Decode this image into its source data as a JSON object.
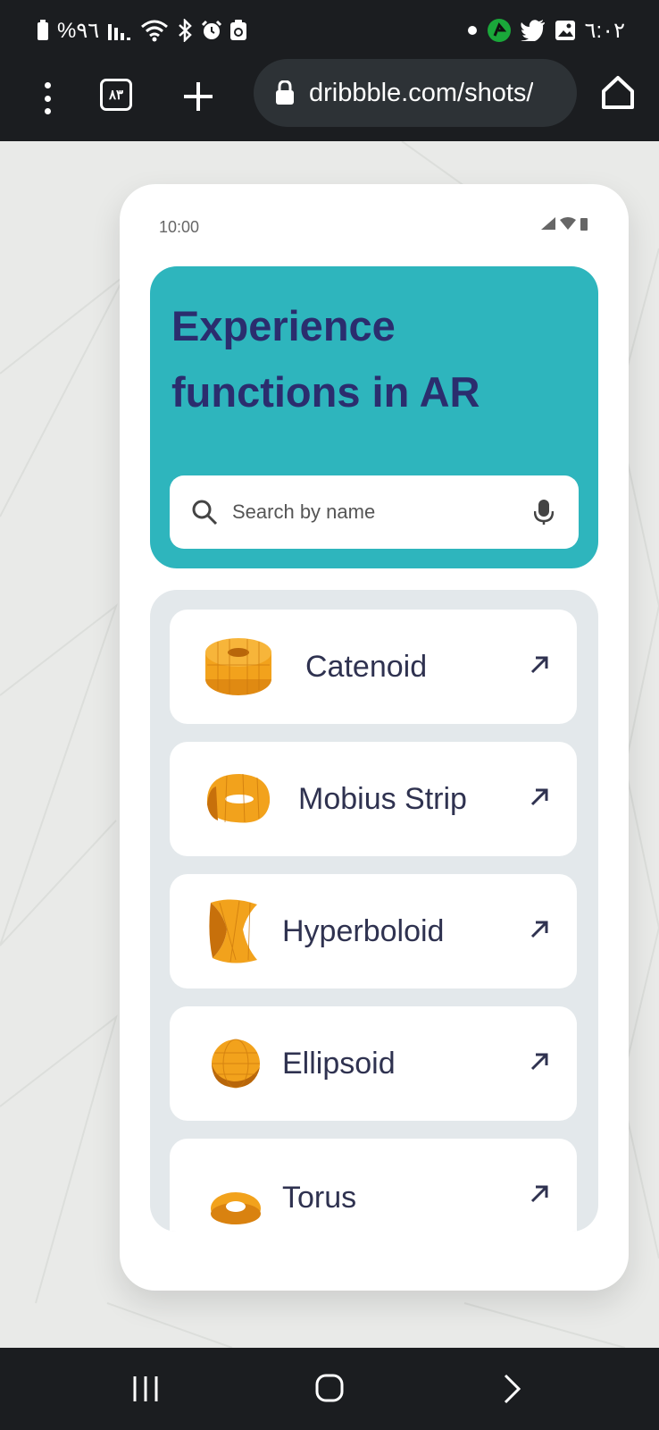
{
  "status_bar": {
    "battery_text": "%٩٦",
    "time": "٦:٠٢"
  },
  "browser": {
    "tab_count": "٨٣",
    "url": "dribbble.com/shots/"
  },
  "mockup": {
    "time": "10:00",
    "hero_title_line1": "Experience",
    "hero_title_line2": "functions in AR",
    "search_placeholder": "Search by name",
    "items": [
      {
        "label": "Catenoid",
        "shape": "catenoid"
      },
      {
        "label": "Mobius Strip",
        "shape": "mobius-strip"
      },
      {
        "label": "Hyperboloid",
        "shape": "hyperboloid"
      },
      {
        "label": "Ellipsoid",
        "shape": "ellipsoid"
      },
      {
        "label": "Torus",
        "shape": "torus"
      }
    ]
  },
  "colors": {
    "hero_bg": "#2eb5bd",
    "hero_text": "#2b2d6e",
    "list_bg": "#e3e8eb",
    "shape_orange": "#f2a21c"
  }
}
